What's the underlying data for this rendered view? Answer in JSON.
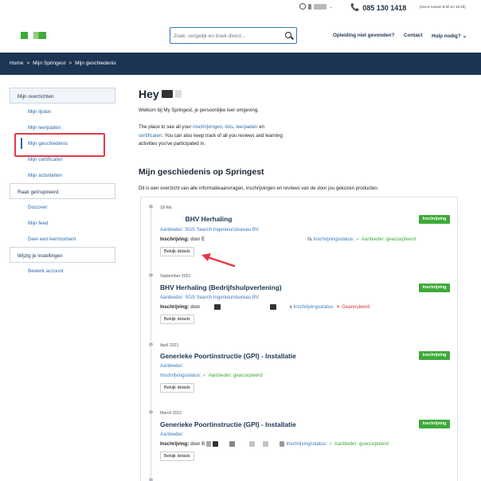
{
  "topbar": {
    "phone": "085 130 1418",
    "hours": "(ma-vr tussen 8:30 en 16:30)"
  },
  "header": {
    "search_placeholder": "Zoek, vergelijk en boek direct...",
    "nav": [
      "Opleiding niet gevonden?",
      "Contact",
      "Hulp nodig?"
    ]
  },
  "breadcrumb": [
    "Home",
    ">",
    "Mijn Springest",
    ">",
    "Mijn geschiedenis"
  ],
  "sidebar": {
    "sections": [
      {
        "title": "Mijn overzichten",
        "items": [
          "Mijn lijsten",
          "Mijn leerpaden",
          "Mijn geschiedenis",
          "Mijn certificaten",
          "Mijn activiteiten"
        ]
      },
      {
        "title": "Raak geïnspireerd",
        "items": [
          "Discover",
          "Mijn feed",
          "Deel een leermoment"
        ]
      },
      {
        "title": "Wijzig je instellingen",
        "items": [
          "Bewerk account"
        ]
      }
    ]
  },
  "main": {
    "greeting": "Hey",
    "welcome": "Welkom bij My Springest, je persoonlijke leer omgeving.",
    "intro": {
      "t1": "The place to see all your ",
      "l1": "inschrijvingen",
      "t2": ", ",
      "l2": "lists",
      "t3": ", ",
      "l3": "leerpaden",
      "t4": " en ",
      "l4": "certificaten",
      "t5": ". You can also keep track of all you reviews and learning activities you've participated in."
    },
    "section_title": "Mijn geschiedenis op Springest",
    "section_desc": "Dit is een overzicht van alle informatieaanvragen, inschrijvingen en reviews van de door jou gekozen producten."
  },
  "entries": [
    {
      "date": "18 feb.",
      "title": "BHV Herhaling",
      "provider": "Aanbieder: SGS Search Ingenieursbureau BV",
      "enroll_label": "Inschrijving:",
      "enroll_by": "door E",
      "suffix": "rs",
      "status_label": "Inschrijvingsstatus:",
      "status_icon": "✓",
      "status": "Aanbieder: geaccepteerd",
      "status_kind": "ok",
      "button": "Bekijk details",
      "badge": "Inschrijving"
    },
    {
      "date": "September 2021",
      "title": "BHV Herhaling (Bedrijfshulpverlening)",
      "provider": "Aanbieder: SGS Search Ingenieursbureau BV",
      "enroll_label": "Inschrijving:",
      "enroll_by": "door",
      "suffix": "s",
      "status_label": "Inschrijvingsstatus:",
      "status_icon": "✕",
      "status": "Geannuleerd",
      "status_kind": "bad",
      "button": "Bekijk details",
      "badge": "Inschrijving"
    },
    {
      "date": "April 2021",
      "title": "Generieke Poortinstructie (GPI) - Installatie",
      "provider": "Aanbieder:",
      "status_label": "Inschrijvingsstatus:",
      "status_icon": "✓",
      "status": "Aanbieder: geaccepteerd",
      "status_kind": "ok",
      "button": "Bekijk details",
      "badge": "Inschrijving"
    },
    {
      "date": "March 2021",
      "title": "Generieke Poortinstructie (GPI) - Installatie",
      "provider": "Aanbieder:",
      "enroll_label": "Inschrijving:",
      "enroll_by": "door B",
      "status_label": "Inschrijvingsstatus:",
      "status_icon": "✓",
      "status": "Aanbieder: geaccepteerd",
      "status_kind": "ok",
      "button": "Bekijk details",
      "badge": "Inschrijving"
    }
  ],
  "colors": {
    "navy": "#1c3553",
    "link": "#2b6cb0",
    "green": "#3daa3a",
    "red": "#d13a3a",
    "highlight": "#e53945"
  }
}
